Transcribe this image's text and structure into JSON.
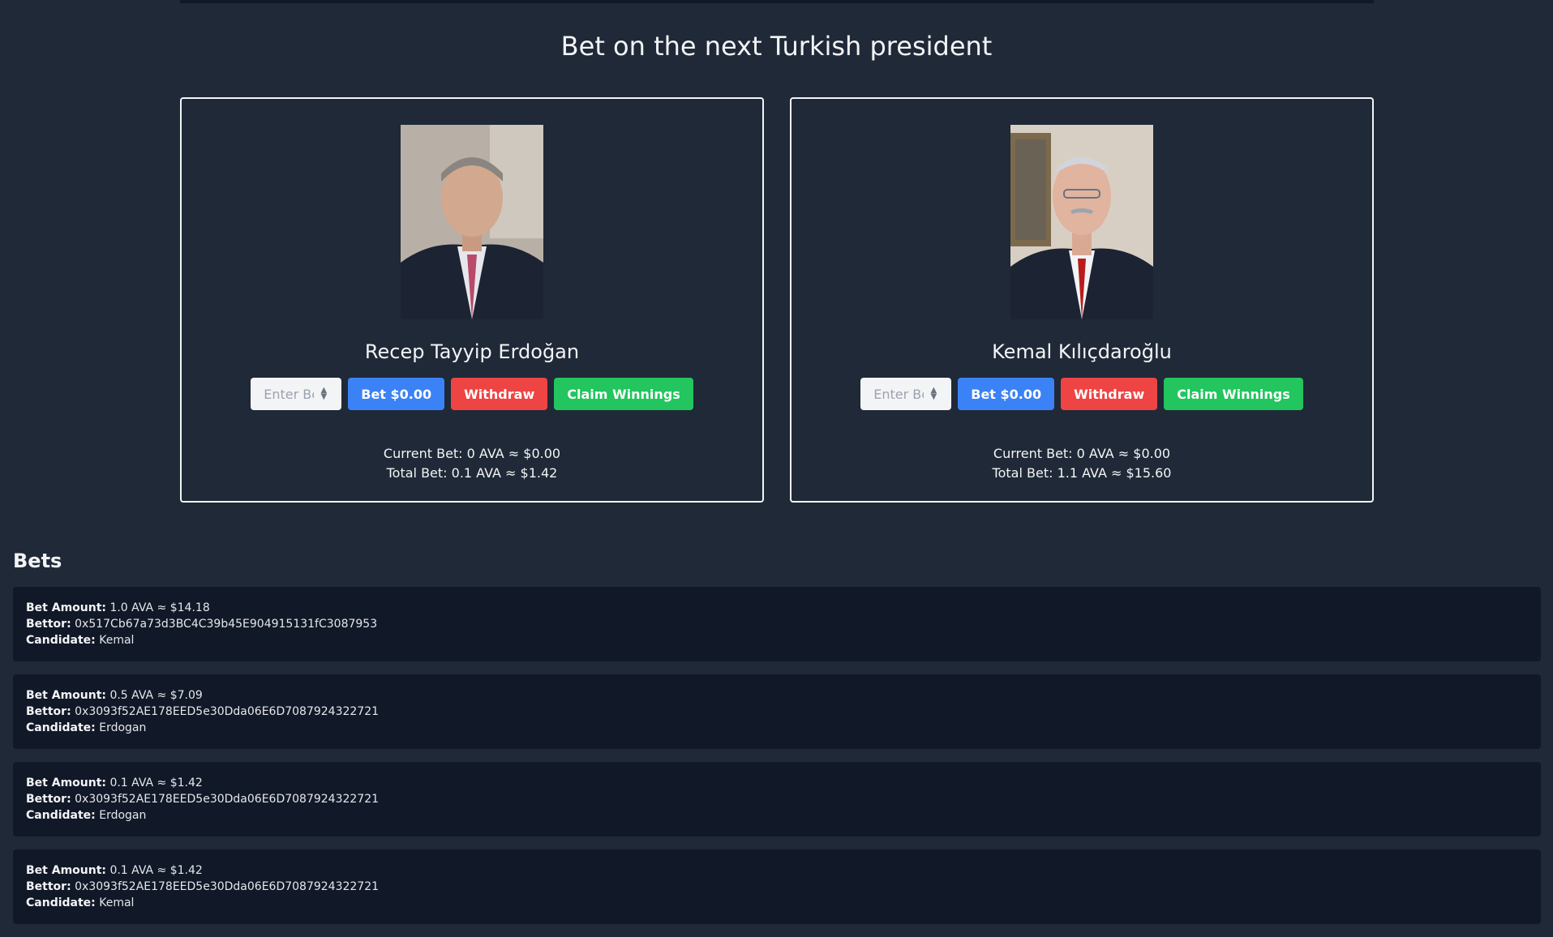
{
  "page": {
    "title": "Bet on the next Turkish president"
  },
  "candidates": [
    {
      "name": "Recep Tayyip Erdoğan",
      "input_placeholder": "Enter Bet",
      "bet_label": "Bet $0.00",
      "withdraw_label": "Withdraw",
      "claim_label": "Claim Winnings",
      "current_bet": "Current Bet: 0 AVA ≈ $0.00",
      "total_bet": "Total Bet: 0.1 AVA ≈ $1.42"
    },
    {
      "name": "Kemal Kılıçdaroğlu",
      "input_placeholder": "Enter Bet",
      "bet_label": "Bet $0.00",
      "withdraw_label": "Withdraw",
      "claim_label": "Claim Winnings",
      "current_bet": "Current Bet: 0 AVA ≈ $0.00",
      "total_bet": "Total Bet: 1.1 AVA ≈ $15.60"
    }
  ],
  "bets_section": {
    "heading": "Bets",
    "labels": {
      "amount": "Bet Amount:",
      "bettor": "Bettor:",
      "candidate": "Candidate:"
    },
    "items": [
      {
        "amount": "1.0 AVA ≈ $14.18",
        "bettor": "0x517Cb67a73d3BC4C39b45E904915131fC3087953",
        "candidate": "Kemal"
      },
      {
        "amount": "0.5 AVA ≈ $7.09",
        "bettor": "0x3093f52AE178EED5e30Dda06E6D7087924322721",
        "candidate": "Erdogan"
      },
      {
        "amount": "0.1 AVA ≈ $1.42",
        "bettor": "0x3093f52AE178EED5e30Dda06E6D7087924322721",
        "candidate": "Erdogan"
      },
      {
        "amount": "0.1 AVA ≈ $1.42",
        "bettor": "0x3093f52AE178EED5e30Dda06E6D7087924322721",
        "candidate": "Kemal"
      }
    ]
  },
  "icons": {
    "spinner": "number-spinner-icon"
  },
  "colors": {
    "background": "#1f2937",
    "card_border": "#f3f4f6",
    "bet_button": "#3b82f6",
    "withdraw_button": "#ef4444",
    "claim_button": "#22c55e",
    "list_item": "#111827"
  }
}
